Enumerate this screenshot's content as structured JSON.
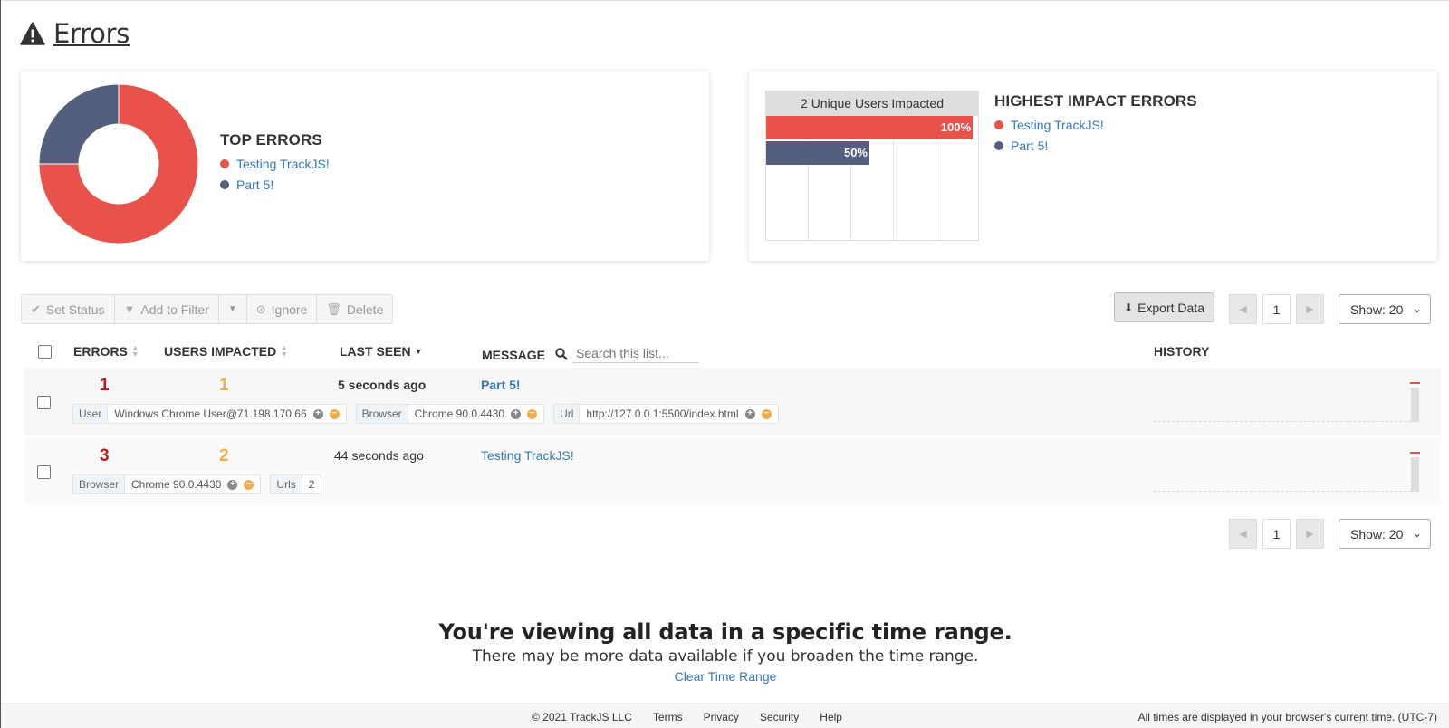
{
  "page": {
    "title": "Errors"
  },
  "top_errors": {
    "heading": "TOP ERRORS",
    "items": [
      {
        "label": "Testing TrackJS!",
        "color": "#e8524a",
        "share": 0.75
      },
      {
        "label": "Part 5!",
        "color": "#545e7f",
        "share": 0.25
      }
    ]
  },
  "impact": {
    "header": "2 Unique Users Impacted",
    "heading": "HIGHEST IMPACT ERRORS",
    "bars": [
      {
        "label": "Testing TrackJS!",
        "percent_text": "100%",
        "value": 1.0,
        "color": "#e8524a"
      },
      {
        "label": "Part 5!",
        "percent_text": "50%",
        "value": 0.5,
        "color": "#545e7f"
      }
    ]
  },
  "toolbar": {
    "set_status": "Set Status",
    "add_to_filter": "Add to Filter",
    "ignore": "Ignore",
    "delete": "Delete",
    "export": "Export Data"
  },
  "pager": {
    "page": "1",
    "show": "Show: 20"
  },
  "table": {
    "headers": {
      "errors": "ERRORS",
      "users": "USERS IMPACTED",
      "last_seen": "LAST SEEN",
      "message": "MESSAGE",
      "history": "HISTORY"
    },
    "search_placeholder": "Search this list...",
    "rows": [
      {
        "errors": "1",
        "users": "1",
        "last_seen": "5 seconds ago",
        "message": "Part 5!",
        "chips": [
          {
            "key": "User",
            "value": "Windows Chrome User@71.198.170.66"
          },
          {
            "key": "Browser",
            "value": "Chrome 90.0.4430"
          },
          {
            "key": "Url",
            "value": "http://127.0.0.1:5500/index.html"
          }
        ]
      },
      {
        "errors": "3",
        "users": "2",
        "last_seen": "44 seconds ago",
        "message": "Testing TrackJS!",
        "chips": [
          {
            "key": "Browser",
            "value": "Chrome 90.0.4430"
          },
          {
            "key": "Urls",
            "value": "2"
          }
        ]
      }
    ]
  },
  "notice": {
    "title": "You're viewing all data in a specific time range.",
    "body": "There may be more data available if you broaden the time range.",
    "link": "Clear Time Range"
  },
  "footer": {
    "copyright": "© 2021 TrackJS LLC",
    "links": [
      "Terms",
      "Privacy",
      "Security",
      "Help"
    ],
    "timezone": "All times are displayed in your browser's current time. (UTC-7)"
  }
}
